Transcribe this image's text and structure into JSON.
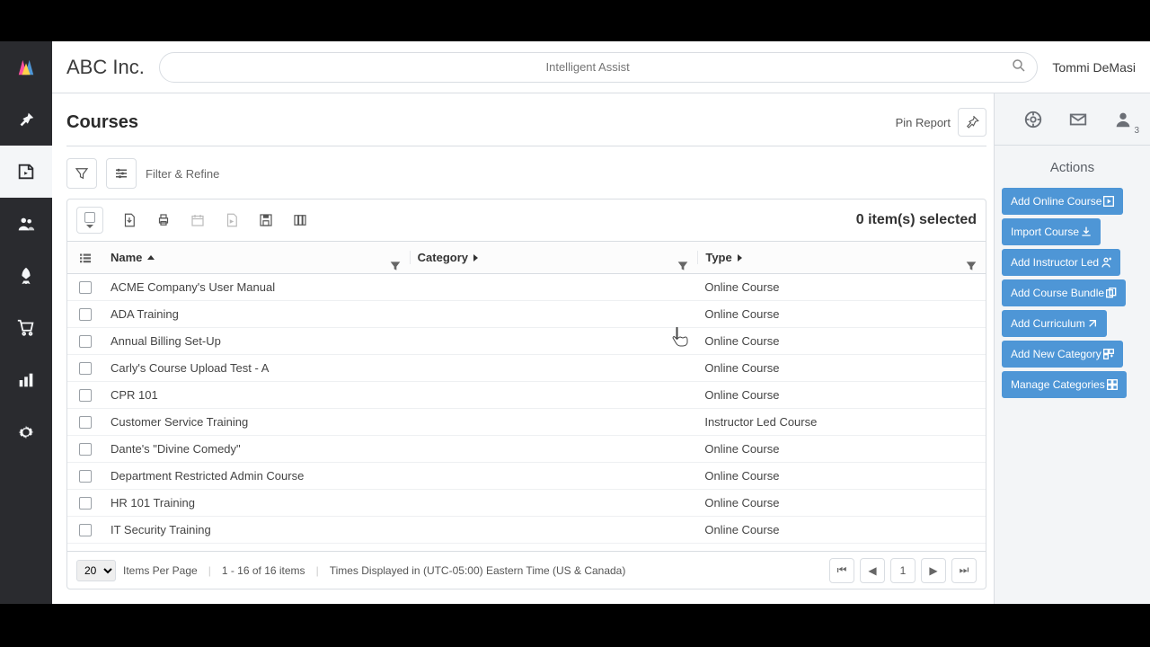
{
  "company": "ABC Inc.",
  "search": {
    "placeholder": "Intelligent Assist"
  },
  "user": {
    "name": "Tommi DeMasi",
    "notif_count": "3"
  },
  "page": {
    "title": "Courses",
    "pin_label": "Pin Report"
  },
  "filter": {
    "label": "Filter & Refine"
  },
  "selection": {
    "text": "0 item(s) selected"
  },
  "columns": {
    "name": "Name",
    "category": "Category",
    "type": "Type"
  },
  "rows": [
    {
      "name": "ACME Company's User Manual",
      "category": "",
      "type": "Online Course"
    },
    {
      "name": "ADA Training",
      "category": "",
      "type": "Online Course"
    },
    {
      "name": "Annual Billing Set-Up",
      "category": "",
      "type": "Online Course"
    },
    {
      "name": "Carly's Course Upload Test - A",
      "category": "",
      "type": "Online Course"
    },
    {
      "name": "CPR 101",
      "category": "",
      "type": "Online Course"
    },
    {
      "name": "Customer Service Training",
      "category": "",
      "type": "Instructor Led Course"
    },
    {
      "name": "Dante's \"Divine Comedy\"",
      "category": "",
      "type": "Online Course"
    },
    {
      "name": "Department Restricted Admin Course",
      "category": "",
      "type": "Online Course"
    },
    {
      "name": "HR 101 Training",
      "category": "",
      "type": "Online Course"
    },
    {
      "name": "IT Security Training",
      "category": "",
      "type": "Online Course"
    }
  ],
  "footer": {
    "per_page_value": "20",
    "per_page_label": "Items Per Page",
    "range": "1 - 16 of 16 items",
    "timezone": "Times Displayed in (UTC-05:00) Eastern Time (US & Canada)",
    "page": "1"
  },
  "actions": {
    "title": "Actions",
    "items": [
      "Add Online Course",
      "Import Course",
      "Add Instructor Led",
      "Add Course Bundle",
      "Add Curriculum",
      "Add New Category",
      "Manage Categories"
    ]
  }
}
